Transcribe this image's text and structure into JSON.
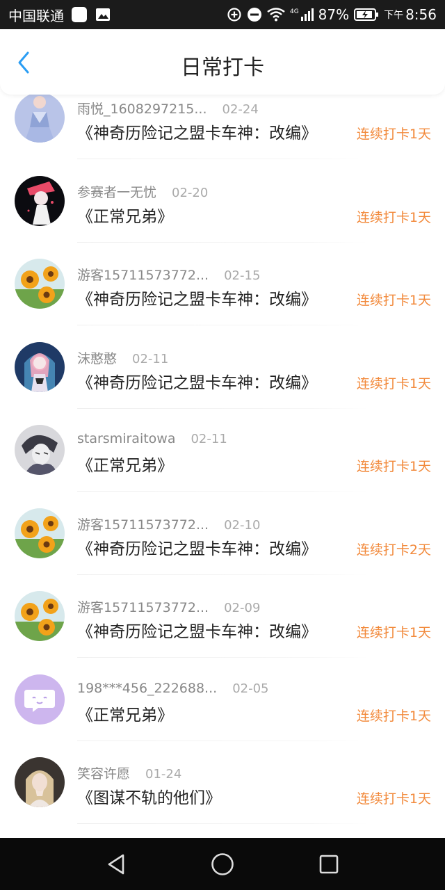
{
  "status_bar": {
    "carrier": "中国联通",
    "battery": "87%",
    "time_prefix": "下午",
    "time": "8:56",
    "network": "4G"
  },
  "header": {
    "title": "日常打卡",
    "back_icon": "chevron-left-icon",
    "accent_color": "#2a9df4"
  },
  "streak_color": "#f28a3c",
  "items": [
    {
      "name": "雨悦_1608297215...",
      "date": "02-24",
      "book": "《神奇历险记之盟卡车神：改编》",
      "streak": "连续打卡1天",
      "avatar": "photo-avatar-girl"
    },
    {
      "name": "参赛者一无忧",
      "date": "02-20",
      "book": "《正常兄弟》",
      "streak": "连续打卡1天",
      "avatar": "anime-avatar"
    },
    {
      "name": "游客15711573772...",
      "date": "02-15",
      "book": "《神奇历险记之盟卡车神：改编》",
      "streak": "连续打卡1天",
      "avatar": "sunflower-avatar"
    },
    {
      "name": "沫憨憨",
      "date": "02-11",
      "book": "《神奇历险记之盟卡车神：改编》",
      "streak": "连续打卡1天",
      "avatar": "anime-avatar-pink"
    },
    {
      "name": "starsmiraitowa",
      "date": "02-11",
      "book": "《正常兄弟》",
      "streak": "连续打卡1天",
      "avatar": "sketch-avatar"
    },
    {
      "name": "游客15711573772...",
      "date": "02-10",
      "book": "《神奇历险记之盟卡车神：改编》",
      "streak": "连续打卡2天",
      "avatar": "sunflower-avatar"
    },
    {
      "name": "游客15711573772...",
      "date": "02-09",
      "book": "《神奇历险记之盟卡车神：改编》",
      "streak": "连续打卡1天",
      "avatar": "sunflower-avatar"
    },
    {
      "name": "198***456_222688...",
      "date": "02-05",
      "book": "《正常兄弟》",
      "streak": "连续打卡1天",
      "avatar": "chat-bubble-avatar"
    },
    {
      "name": "笑容许愿",
      "date": "01-24",
      "book": "《图谋不轨的他们》",
      "streak": "连续打卡1天",
      "avatar": "photo-avatar-blonde"
    }
  ],
  "nav": {
    "back": "triangle-back-icon",
    "home": "circle-home-icon",
    "recents": "square-recents-icon"
  }
}
